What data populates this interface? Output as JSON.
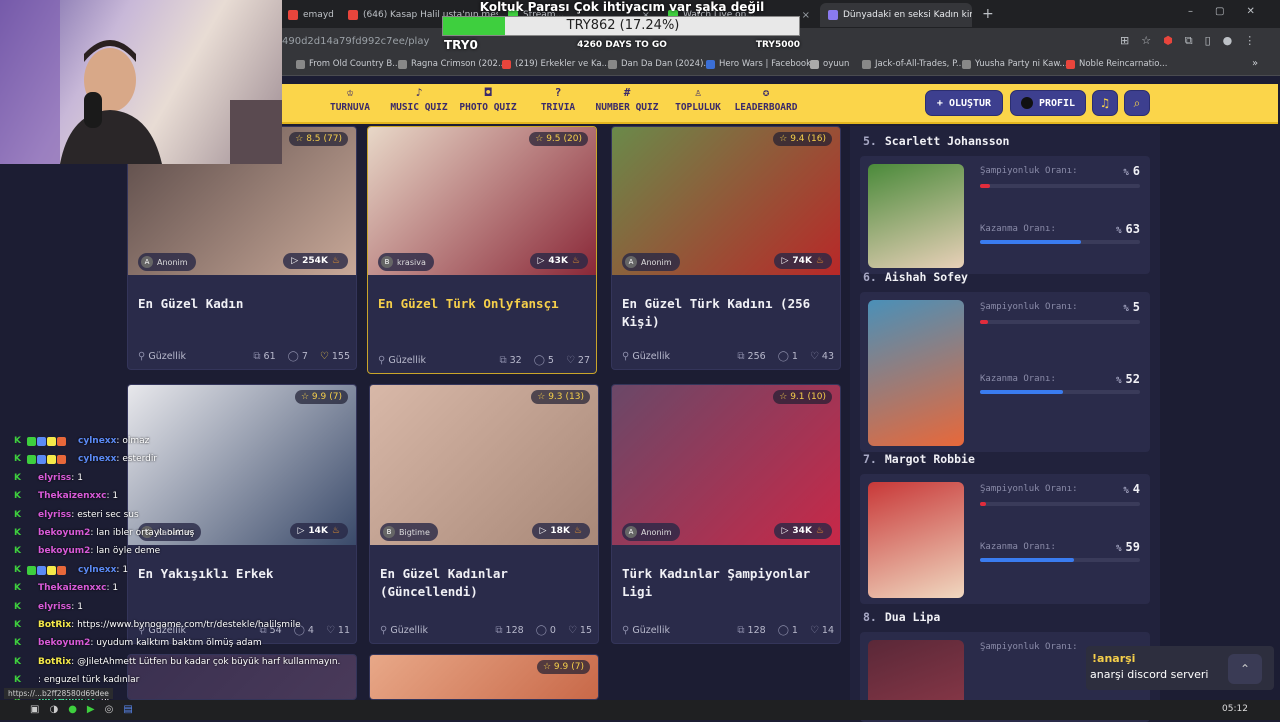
{
  "browser": {
    "tabs": [
      {
        "label": "emayd",
        "color": "#e8453c"
      },
      {
        "label": "(646) Kasap Halil usta'nın mesi...",
        "color": "#e8453c"
      },
      {
        "label": "Stream...",
        "color": "#3ecf3e"
      },
      {
        "label": "Watch Live on...",
        "color": "#3ecf3e"
      },
      {
        "label": "Dünyadaki en seksi Kadın kim...",
        "color": "#8a7af0"
      }
    ],
    "url": "490d2d14a79fd992c7ee/play",
    "bookmarks": [
      {
        "label": "From Old Country B...",
        "color": "#888"
      },
      {
        "label": "Ragna Crimson (202...",
        "color": "#888"
      },
      {
        "label": "(219) Erkekler ve Ka...",
        "color": "#e8453c"
      },
      {
        "label": "Dan Da Dan (2024)...",
        "color": "#888"
      },
      {
        "label": "Hero Wars | Facebook",
        "color": "#3b6fd6"
      },
      {
        "label": "oyuun",
        "color": "#aaa"
      },
      {
        "label": "Jack-of-All-Trades, P...",
        "color": "#888"
      },
      {
        "label": "Yuusha Party ni Kaw...",
        "color": "#888"
      },
      {
        "label": "Noble Reincarnatio...",
        "color": "#e8453c"
      }
    ],
    "more_bookmarks": "»"
  },
  "donation": {
    "title": "Koltuk Parası Çok ihtiyacım var şaka değil",
    "amount": "TRY862 (17.24%)",
    "progress": 17.24,
    "left": "TRY0",
    "days": "4260 DAYS TO GO",
    "right": "TRY5000"
  },
  "nav": {
    "items": [
      {
        "label": "TURNUVA",
        "icon": "trophy-icon",
        "glyph": "♔"
      },
      {
        "label": "MUSIC QUIZ",
        "icon": "music-icon",
        "glyph": "♪"
      },
      {
        "label": "PHOTO QUIZ",
        "icon": "camera-icon",
        "glyph": "◘"
      },
      {
        "label": "TRIVIA",
        "icon": "question-icon",
        "glyph": "?"
      },
      {
        "label": "NUMBER QUIZ",
        "icon": "number-icon",
        "glyph": "#"
      },
      {
        "label": "TOPLULUK",
        "icon": "users-icon",
        "glyph": "♙"
      },
      {
        "label": "LEADERBOARD",
        "icon": "medal-icon",
        "glyph": "✪"
      }
    ],
    "create_label": "OLUŞTUR",
    "create_glyph": "+",
    "profile_label": "PROFIL"
  },
  "cards": [
    {
      "rating": "8.5",
      "votes": "(77)",
      "author": "Anonim",
      "author_initial": "A",
      "views": "254K",
      "title": "En Güzel Kadın",
      "category": "Güzellik",
      "items": "61",
      "comments": "7",
      "likes": "155",
      "img": [
        "#5a4a48",
        "#c8a898"
      ]
    },
    {
      "rating": "9.5",
      "votes": "(20)",
      "author": "krasiva",
      "author_initial": "B",
      "views": "43K",
      "title": "En Güzel Türk Onlyfansçı",
      "category": "Güzellik",
      "items": "32",
      "comments": "5",
      "likes": "27",
      "img": [
        "#e8d8c8",
        "#8a2838"
      ]
    },
    {
      "rating": "9.4",
      "votes": "(16)",
      "author": "Anonim",
      "author_initial": "A",
      "views": "74K",
      "title": "En Güzel Türk Kadını (256 Kişi)",
      "category": "Güzellik",
      "items": "256",
      "comments": "1",
      "likes": "43",
      "img": [
        "#6a8a4a",
        "#b82828"
      ]
    },
    {
      "rating": "9.9",
      "votes": "(7)",
      "author": "Kabaklav",
      "author_initial": "K",
      "views": "14K",
      "title": "En Yakışıklı Erkek",
      "category": "Güzellik",
      "items": "54",
      "comments": "4",
      "likes": "11",
      "img": [
        "#e8e8ec",
        "#3a4a6a"
      ]
    },
    {
      "rating": "9.3",
      "votes": "(13)",
      "author": "Bigtime",
      "author_initial": "B",
      "views": "18K",
      "title": "En Güzel Kadınlar (Güncellendi)",
      "category": "Güzellik",
      "items": "128",
      "comments": "0",
      "likes": "15",
      "img": [
        "#d8b8a8",
        "#a88878"
      ]
    },
    {
      "rating": "9.1",
      "votes": "(10)",
      "author": "Anonim",
      "author_initial": "A",
      "views": "34K",
      "title": "Türk Kadınlar Şampiyonlar Ligi",
      "category": "Güzellik",
      "items": "128",
      "comments": "1",
      "likes": "14",
      "img": [
        "#6a4868",
        "#c82848"
      ]
    },
    {
      "rating": "",
      "votes": "",
      "author": "",
      "author_initial": "",
      "views": "",
      "title": "",
      "category": "",
      "items": "",
      "comments": "",
      "likes": "",
      "img": [
        "#3a3050",
        "#4a3a5a"
      ]
    },
    {
      "rating": "9.9",
      "votes": "(7)",
      "author": "",
      "author_initial": "",
      "views": "",
      "title": "",
      "category": "",
      "items": "",
      "comments": "",
      "likes": "",
      "img": [
        "#e8a888",
        "#c86848"
      ]
    }
  ],
  "ranking": {
    "champ_label": "Şampiyonluk Oranı:",
    "win_label": "Kazanma Oranı:",
    "percent_sign": "%",
    "entries": [
      {
        "num": "5.",
        "name": "Scarlett Johansson",
        "champ": "6",
        "champ_value": 6,
        "win": "63",
        "win_value": 63,
        "img": [
          "#4a8a3a",
          "#e8d0b8"
        ]
      },
      {
        "num": "6.",
        "name": "Aishah Sofey",
        "champ": "5",
        "champ_value": 5,
        "win": "52",
        "win_value": 52,
        "img": [
          "#4a90b8",
          "#e8683a"
        ]
      },
      {
        "num": "7.",
        "name": "Margot Robbie",
        "champ": "4",
        "champ_value": 4,
        "win": "59",
        "win_value": 59,
        "img": [
          "#c83838",
          "#f0d8c0"
        ]
      },
      {
        "num": "8.",
        "name": "Dua Lipa",
        "champ": "",
        "champ_value": 0,
        "win": "",
        "win_value": 0,
        "img": [
          "#5a2838",
          "#8a3848"
        ]
      }
    ],
    "champ_color": "#e02c3c",
    "win_color": "#3a7cf0"
  },
  "chat": [
    {
      "user": "cylnexx",
      "msg": ": olmaz",
      "color": "#5b8af5",
      "badges": true
    },
    {
      "user": "cylnexx",
      "msg": ": esterdir",
      "color": "#5b8af5",
      "badges": true
    },
    {
      "user": "elyriss",
      "msg": ": 1",
      "color": "#d85ad8",
      "badges": false
    },
    {
      "user": "Thekaizenxxc",
      "msg": ": 1",
      "color": "#d85ad8",
      "badges": false
    },
    {
      "user": "elyriss",
      "msg": ": esteri sec sus",
      "color": "#d85ad8",
      "badges": false
    },
    {
      "user": "bekoyum2",
      "msg": ": lan ibler ortaylı olmuş",
      "color": "#d85ad8",
      "badges": false
    },
    {
      "user": "bekoyum2",
      "msg": ": lan öyle deme",
      "color": "#d85ad8",
      "badges": false
    },
    {
      "user": "cylnexx",
      "msg": ": 1",
      "color": "#5b8af5",
      "badges": true
    },
    {
      "user": "Thekaizenxxc",
      "msg": ": 1",
      "color": "#d85ad8",
      "badges": false
    },
    {
      "user": "elyriss",
      "msg": ": 1",
      "color": "#d85ad8",
      "badges": false
    },
    {
      "user": "BotRix",
      "msg": ": https://www.bynogame.com/tr/destekle/halilsmile",
      "color": "#f5e94a",
      "badges": false
    },
    {
      "user": "bekoyum2",
      "msg": ": uyudum kalktım baktım ölmüş adam",
      "color": "#d85ad8",
      "badges": false
    },
    {
      "user": "BotRix",
      "msg": ": @JiletAhmett Lütfen bu kadar çok büyük harf kullanmayın.",
      "color": "#f5e94a",
      "badges": false
    },
    {
      "user": "",
      "msg": ": enguzel türk kadınlar",
      "color": "#d85ad8",
      "badges": false
    },
    {
      "user": "JiletAhmett",
      "msg": ": aç",
      "color": "#4af5a8",
      "badges": false
    }
  ],
  "status_url": "https://...b2ff28580d69dee",
  "toast": {
    "title": "!anarşi",
    "body": "anarşi discord serveri"
  },
  "taskbar": {
    "time": "05:12"
  },
  "colors": {
    "brand_yellow": "#fbd54a",
    "brand_purple": "#3d3f8f",
    "bg": "#1c1d33",
    "card": "#2a2b4a"
  }
}
